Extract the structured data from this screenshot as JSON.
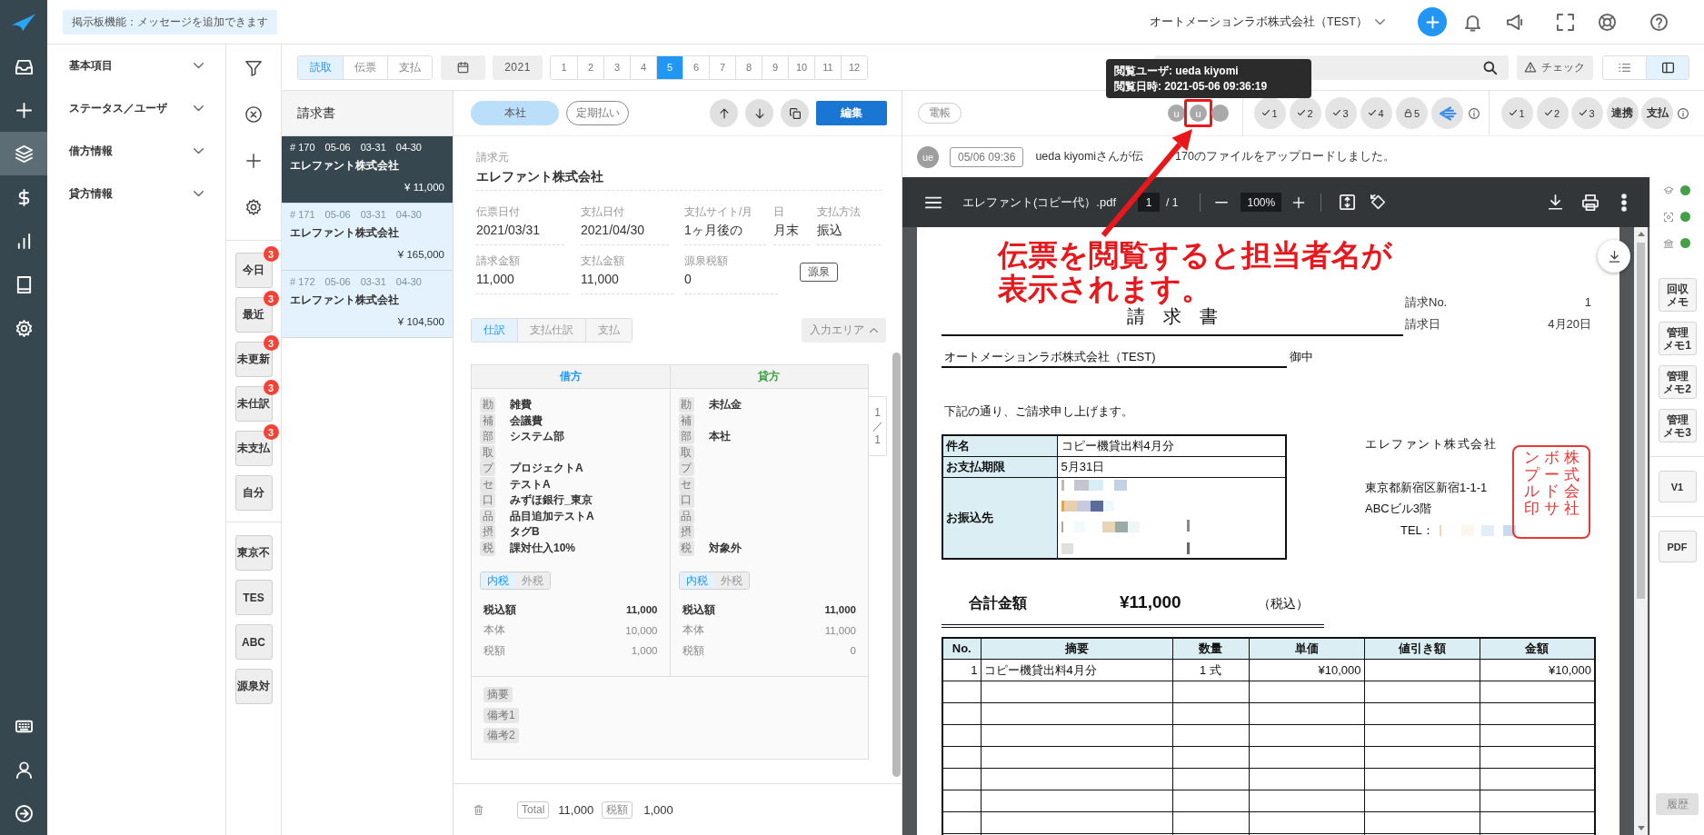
{
  "nav": {
    "items": [
      {
        "selected": false
      },
      {
        "selected": false
      },
      {
        "selected": true
      },
      {
        "selected": false
      },
      {
        "selected": false
      },
      {
        "selected": false
      },
      {
        "selected": false
      }
    ]
  },
  "header": {
    "notice": "掲示板機能：メッセージを追加できます",
    "company": "オートメーションラボ株式会社（TEST）"
  },
  "filter_panel": {
    "sections": [
      {
        "label": "基本項目",
        "expanded": false
      },
      {
        "label": "ステータス／ユーザ",
        "expanded": false
      },
      {
        "label": "借方情報",
        "expanded": false
      },
      {
        "label": "貸方情報",
        "expanded": false
      }
    ]
  },
  "quick_filters": {
    "status": [
      {
        "label": "今日",
        "badge": "3"
      },
      {
        "label": "最近",
        "badge": "3"
      },
      {
        "label": "未更新",
        "badge": "3"
      },
      {
        "label": "未仕訳",
        "badge": "3"
      },
      {
        "label": "未支払",
        "badge": "3"
      },
      {
        "label": "自分"
      }
    ],
    "saved": [
      {
        "label": "東京不"
      },
      {
        "label": "TES"
      },
      {
        "label": "ABC"
      },
      {
        "label": "源泉対"
      }
    ]
  },
  "toolbar": {
    "modes": [
      {
        "label": "読取",
        "selected": true
      },
      {
        "label": "伝票",
        "selected": false
      },
      {
        "label": "支払",
        "selected": false
      }
    ],
    "year": "2021",
    "months": [
      {
        "label": "1",
        "selected": false
      },
      {
        "label": "2",
        "selected": false
      },
      {
        "label": "3",
        "selected": false
      },
      {
        "label": "4",
        "selected": false
      },
      {
        "label": "5",
        "selected": true
      },
      {
        "label": "6",
        "selected": false
      },
      {
        "label": "7",
        "selected": false
      },
      {
        "label": "8",
        "selected": false
      },
      {
        "label": "9",
        "selected": false
      },
      {
        "label": "10",
        "selected": false
      },
      {
        "label": "11",
        "selected": false
      },
      {
        "label": "12",
        "selected": false
      }
    ],
    "check_button": "チェック",
    "views": [
      {
        "selected": false
      },
      {
        "selected": true
      }
    ]
  },
  "document_list": {
    "title": "請求書",
    "items": [
      {
        "number": "# 170",
        "dates": [
          "05-06",
          "03-31",
          "04-30"
        ],
        "name": "エレファント株式会社",
        "amount": "¥ 11,000",
        "selected": true
      },
      {
        "number": "# 171",
        "dates": [
          "05-06",
          "03-31",
          "04-30"
        ],
        "name": "エレファント株式会社",
        "amount": "¥ 165,000",
        "selected": false
      },
      {
        "number": "# 172",
        "dates": [
          "05-06",
          "03-31",
          "04-30"
        ],
        "name": "エレファント株式会社",
        "amount": "¥ 104,500",
        "selected": false
      }
    ]
  },
  "detail": {
    "branch": "本社",
    "recurring": "定期払い",
    "edit_button": "編集",
    "issuer": {
      "label": "請求元",
      "value": "エレファント株式会社"
    },
    "dates_row": [
      {
        "label": "伝票日付",
        "value": "2021/03/31"
      },
      {
        "label": "支払日付",
        "value": "2021/04/30"
      },
      {
        "label": "支払サイト/月",
        "value": "1ヶ月後の"
      },
      {
        "label": "日",
        "value": "月末"
      },
      {
        "label": "支払方法",
        "value": "振込"
      }
    ],
    "amounts_row": [
      {
        "label": "請求金額",
        "value": "11,000"
      },
      {
        "label": "支払金額",
        "value": "11,000"
      },
      {
        "label": "源泉税額",
        "value": "0"
      }
    ],
    "withholding_button": "源泉",
    "tabs": [
      {
        "label": "仕訳",
        "selected": true
      },
      {
        "label": "支払仕訳",
        "selected": false
      },
      {
        "label": "支払",
        "selected": false
      }
    ],
    "input_area": {
      "label": "入力エリア",
      "expanded": true
    },
    "journal": {
      "sides": [
        {
          "kind": "debit",
          "title": "借方",
          "lines": [
            {
              "tag": "勘",
              "value": "雑費"
            },
            {
              "tag": "補",
              "value": "会議費"
            },
            {
              "tag": "部",
              "value": "システム部"
            },
            {
              "tag": "取"
            },
            {
              "tag": "プ",
              "value": "プロジェクトA"
            },
            {
              "tag": "セ",
              "value": "テストA"
            },
            {
              "tag": "口",
              "value": "みずほ銀行_東京"
            },
            {
              "tag": "品",
              "value": "品目追加テストA"
            },
            {
              "tag": "摂",
              "value": "タグB"
            },
            {
              "tag": "税",
              "value": "課対仕入10%"
            }
          ],
          "tax_modes": [
            {
              "label": "内税",
              "selected": true
            },
            {
              "label": "外税",
              "selected": false
            }
          ],
          "totals": [
            {
              "kind": "total",
              "label": "税込額",
              "value": "11,000"
            },
            {
              "kind": "part",
              "label": "本体",
              "value": "10,000"
            },
            {
              "kind": "part",
              "label": "税額",
              "value": "1,000"
            }
          ]
        },
        {
          "kind": "credit",
          "title": "貸方",
          "lines": [
            {
              "tag": "勘",
              "value": "未払金"
            },
            {
              "tag": "補"
            },
            {
              "tag": "部",
              "value": "本社"
            },
            {
              "tag": "取"
            },
            {
              "tag": "プ"
            },
            {
              "tag": "セ"
            },
            {
              "tag": "口"
            },
            {
              "tag": "品"
            },
            {
              "tag": "摂"
            },
            {
              "tag": "税",
              "value": "対象外"
            }
          ],
          "tax_modes": [
            {
              "label": "内税",
              "selected": true
            },
            {
              "label": "外税",
              "selected": false
            }
          ],
          "totals": [
            {
              "kind": "total",
              "label": "税込額",
              "value": "11,000"
            },
            {
              "kind": "part",
              "label": "本体",
              "value": "11,000"
            },
            {
              "kind": "part",
              "label": "税額",
              "value": "0"
            }
          ]
        }
      ],
      "notes": [
        "摘要",
        "備考1",
        "備考2"
      ],
      "pager": {
        "current": "1",
        "separator": "／",
        "total": "1"
      }
    },
    "footer": {
      "total_label": "Total",
      "total": "11,000",
      "tax_label": "税額",
      "tax": "1,000"
    }
  },
  "approvals": {
    "ledger_badge": "電帳",
    "viewers": [
      {
        "initial": "u",
        "highlighted": false
      },
      {
        "initial": "u",
        "highlighted": true
      },
      {
        "highlighted": false
      }
    ],
    "steps": [
      {
        "kind": "check",
        "label": "1"
      },
      {
        "kind": "check",
        "label": "2"
      },
      {
        "kind": "check",
        "label": "3"
      },
      {
        "kind": "check",
        "label": "4"
      },
      {
        "kind": "lock",
        "label": "5"
      },
      {
        "kind": "logo"
      }
    ],
    "stages": [
      {
        "kind": "check",
        "label": "1"
      },
      {
        "kind": "check",
        "label": "2"
      },
      {
        "kind": "check",
        "label": "3"
      },
      {
        "kind": "text",
        "label": "連携"
      },
      {
        "kind": "text",
        "label": "支払"
      }
    ]
  },
  "activity": {
    "avatar": "ue",
    "time": "05/06 09:36",
    "message": [
      "ueda kiyomiさんが伝",
      "170のファイルをアップロードしました。"
    ]
  },
  "viewer": {
    "file_name": "エレファント(コピー代）.pdf",
    "page": "1",
    "page_of": "/ 1",
    "zoom": "100%"
  },
  "invoice": {
    "title": "請　求　書",
    "meta": [
      {
        "label": "請求No.",
        "value": "1"
      },
      {
        "label": "請求日",
        "value": "4月20日"
      }
    ],
    "addressee": "オートメーションラボ株式会社（TEST)",
    "honorific": "御中",
    "intro": "下記の通り、ご請求申し上げます。",
    "info": [
      {
        "label": "件名",
        "value": "コピー機貸出料4月分"
      },
      {
        "label": "お支払期限",
        "value": "5月31日"
      },
      {
        "label": "お振込先",
        "redacted": true
      }
    ],
    "issuer": {
      "name": "エレファント株式会社",
      "address": [
        "東京都新宿区新宿1-1-1",
        "ABCビル3階"
      ],
      "tel_label": "TEL：",
      "tel_redacted": true,
      "stamp": [
        "ンプル印",
        "ボードサ",
        "株式会社"
      ]
    },
    "total": {
      "label": "合計金額",
      "amount": "¥11,000",
      "note": "（税込）"
    },
    "items": {
      "columns": [
        "No.",
        "摘要",
        "数量",
        "単価",
        "値引き額",
        "金額"
      ],
      "rows": [
        [
          "1",
          "コピー機貸出料4月分",
          "1 式",
          "¥10,000",
          null,
          "¥10,000"
        ]
      ]
    }
  },
  "side_tools": {
    "statuses": [
      {
        "on": true
      },
      {
        "on": true
      },
      {
        "on": true
      }
    ],
    "memos": [
      {
        "lines": [
          "回収",
          "メモ"
        ]
      },
      {
        "lines": [
          "管理",
          "メモ1"
        ]
      },
      {
        "lines": [
          "管理",
          "メモ2"
        ]
      },
      {
        "lines": [
          "管理",
          "メモ3"
        ]
      }
    ],
    "version": "V1",
    "pdf": "PDF",
    "history": {
      "label": "履歴",
      "disabled": true
    }
  },
  "tooltip": {
    "lines": [
      "閲覧ユーザ: ueda kiyomi",
      "閲覧日時: 2021-05-06 09:36:19"
    ]
  },
  "annotation": {
    "text": "伝票を閲覧すると担当者名が表示されます。"
  }
}
